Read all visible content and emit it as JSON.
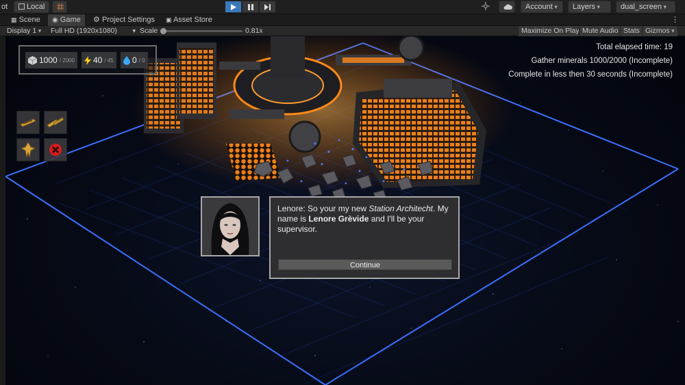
{
  "toolbar": {
    "fragment": "ot",
    "local": "Local",
    "account": "Account",
    "layers": "Layers",
    "layout": "dual_screen"
  },
  "tabs": [
    {
      "label": "Scene"
    },
    {
      "label": "Game"
    },
    {
      "label": "Project Settings"
    },
    {
      "label": "Asset Store"
    }
  ],
  "gamebar": {
    "display": "Display 1",
    "resolution": "Full HD (1920x1080)",
    "scale_label": "Scale",
    "scale_value": "0.81x",
    "maximize": "Maximize On Play",
    "mute": "Mute Audio",
    "stats": "Stats",
    "gizmos": "Gizmos"
  },
  "hud": {
    "minerals": {
      "value": "1000",
      "max": "/ 2000"
    },
    "energy": {
      "value": "40",
      "max": "/ 45"
    },
    "water": {
      "value": "0",
      "max": "/ 0"
    }
  },
  "objectives": {
    "elapsed": "Total elapsed time: 19",
    "gather": "Gather minerals 1000/2000  (Incomplete)",
    "complete": "Complete in less then  30 seconds (Incomplete)"
  },
  "dialog": {
    "p1": "Lenore: So your my new ",
    "p2": "Station Architecht",
    "p3": ". My name is ",
    "p4": "Lenore Grèvide",
    "p5": " and I'll be your supervisor.",
    "continue_label": "Continue"
  },
  "colors": {
    "accent": "#3a79bb",
    "grid": "#2b5cff",
    "glow": "#ff8a1a",
    "cancel": "#d21e1e"
  }
}
